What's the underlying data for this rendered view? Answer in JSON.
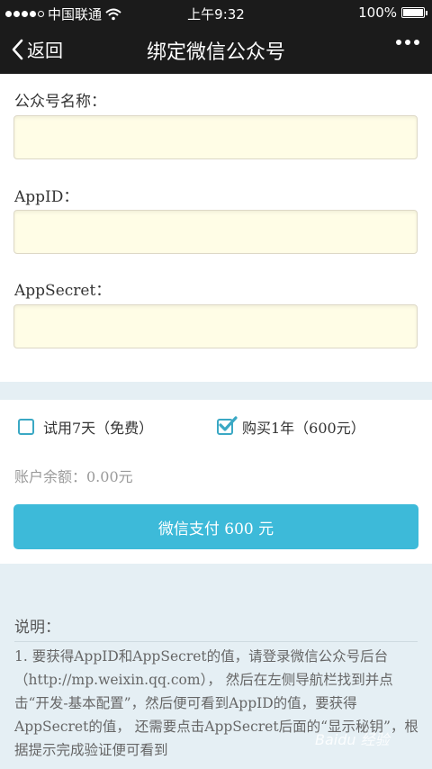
{
  "status_bar": {
    "carrier": "中国联通",
    "time": "上午9:32",
    "battery": "100%",
    "icons": [
      "signal-dots-icon",
      "wifi-icon",
      "battery-icon"
    ]
  },
  "nav": {
    "back_label": "返回",
    "title": "绑定微信公众号",
    "icons": [
      "chevron-left-icon",
      "more-dots-icon"
    ]
  },
  "form": {
    "name_label": "公众号名称：",
    "name_value": "",
    "appid_label": "AppID：",
    "appid_value": "",
    "secret_label": "AppSecret：",
    "secret_value": ""
  },
  "plans": {
    "trial_label": "试用7天（免费）",
    "trial_checked": false,
    "yearly_label": "购买1年（600元）",
    "yearly_checked": true
  },
  "balance_text": "账户余额：0.00元",
  "pay_button_label": "微信支付 600 元",
  "notes": {
    "title": "说明：",
    "body": "1. 要获得AppID和AppSecret的值，请登录微信公众号后台（http://mp.weixin.qq.com）， 然后在左侧导航栏找到并点击“开发-基本配置”，然后便可看到AppID的值，要获得AppSecret的值， 还需要点击AppSecret后面的“显示秘钥”，根据提示完成验证便可看到"
  },
  "watermark": "Baidu 经验",
  "colors": {
    "bar": "#1b1b1b",
    "input_bg": "#fffde6",
    "band": "#e5eff4",
    "accent": "#3dbad9"
  }
}
